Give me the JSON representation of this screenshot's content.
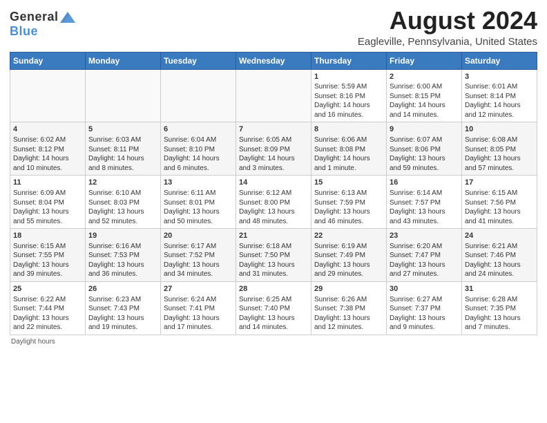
{
  "header": {
    "logo": {
      "general": "General",
      "blue": "Blue"
    },
    "title": "August 2024",
    "subtitle": "Eagleville, Pennsylvania, United States"
  },
  "calendar": {
    "weekdays": [
      "Sunday",
      "Monday",
      "Tuesday",
      "Wednesday",
      "Thursday",
      "Friday",
      "Saturday"
    ],
    "weeks": [
      [
        {
          "day": "",
          "content": ""
        },
        {
          "day": "",
          "content": ""
        },
        {
          "day": "",
          "content": ""
        },
        {
          "day": "",
          "content": ""
        },
        {
          "day": "1",
          "content": "Sunrise: 5:59 AM\nSunset: 8:16 PM\nDaylight: 14 hours and 16 minutes."
        },
        {
          "day": "2",
          "content": "Sunrise: 6:00 AM\nSunset: 8:15 PM\nDaylight: 14 hours and 14 minutes."
        },
        {
          "day": "3",
          "content": "Sunrise: 6:01 AM\nSunset: 8:14 PM\nDaylight: 14 hours and 12 minutes."
        }
      ],
      [
        {
          "day": "4",
          "content": "Sunrise: 6:02 AM\nSunset: 8:12 PM\nDaylight: 14 hours and 10 minutes."
        },
        {
          "day": "5",
          "content": "Sunrise: 6:03 AM\nSunset: 8:11 PM\nDaylight: 14 hours and 8 minutes."
        },
        {
          "day": "6",
          "content": "Sunrise: 6:04 AM\nSunset: 8:10 PM\nDaylight: 14 hours and 6 minutes."
        },
        {
          "day": "7",
          "content": "Sunrise: 6:05 AM\nSunset: 8:09 PM\nDaylight: 14 hours and 3 minutes."
        },
        {
          "day": "8",
          "content": "Sunrise: 6:06 AM\nSunset: 8:08 PM\nDaylight: 14 hours and 1 minute."
        },
        {
          "day": "9",
          "content": "Sunrise: 6:07 AM\nSunset: 8:06 PM\nDaylight: 13 hours and 59 minutes."
        },
        {
          "day": "10",
          "content": "Sunrise: 6:08 AM\nSunset: 8:05 PM\nDaylight: 13 hours and 57 minutes."
        }
      ],
      [
        {
          "day": "11",
          "content": "Sunrise: 6:09 AM\nSunset: 8:04 PM\nDaylight: 13 hours and 55 minutes."
        },
        {
          "day": "12",
          "content": "Sunrise: 6:10 AM\nSunset: 8:03 PM\nDaylight: 13 hours and 52 minutes."
        },
        {
          "day": "13",
          "content": "Sunrise: 6:11 AM\nSunset: 8:01 PM\nDaylight: 13 hours and 50 minutes."
        },
        {
          "day": "14",
          "content": "Sunrise: 6:12 AM\nSunset: 8:00 PM\nDaylight: 13 hours and 48 minutes."
        },
        {
          "day": "15",
          "content": "Sunrise: 6:13 AM\nSunset: 7:59 PM\nDaylight: 13 hours and 46 minutes."
        },
        {
          "day": "16",
          "content": "Sunrise: 6:14 AM\nSunset: 7:57 PM\nDaylight: 13 hours and 43 minutes."
        },
        {
          "day": "17",
          "content": "Sunrise: 6:15 AM\nSunset: 7:56 PM\nDaylight: 13 hours and 41 minutes."
        }
      ],
      [
        {
          "day": "18",
          "content": "Sunrise: 6:15 AM\nSunset: 7:55 PM\nDaylight: 13 hours and 39 minutes."
        },
        {
          "day": "19",
          "content": "Sunrise: 6:16 AM\nSunset: 7:53 PM\nDaylight: 13 hours and 36 minutes."
        },
        {
          "day": "20",
          "content": "Sunrise: 6:17 AM\nSunset: 7:52 PM\nDaylight: 13 hours and 34 minutes."
        },
        {
          "day": "21",
          "content": "Sunrise: 6:18 AM\nSunset: 7:50 PM\nDaylight: 13 hours and 31 minutes."
        },
        {
          "day": "22",
          "content": "Sunrise: 6:19 AM\nSunset: 7:49 PM\nDaylight: 13 hours and 29 minutes."
        },
        {
          "day": "23",
          "content": "Sunrise: 6:20 AM\nSunset: 7:47 PM\nDaylight: 13 hours and 27 minutes."
        },
        {
          "day": "24",
          "content": "Sunrise: 6:21 AM\nSunset: 7:46 PM\nDaylight: 13 hours and 24 minutes."
        }
      ],
      [
        {
          "day": "25",
          "content": "Sunrise: 6:22 AM\nSunset: 7:44 PM\nDaylight: 13 hours and 22 minutes."
        },
        {
          "day": "26",
          "content": "Sunrise: 6:23 AM\nSunset: 7:43 PM\nDaylight: 13 hours and 19 minutes."
        },
        {
          "day": "27",
          "content": "Sunrise: 6:24 AM\nSunset: 7:41 PM\nDaylight: 13 hours and 17 minutes."
        },
        {
          "day": "28",
          "content": "Sunrise: 6:25 AM\nSunset: 7:40 PM\nDaylight: 13 hours and 14 minutes."
        },
        {
          "day": "29",
          "content": "Sunrise: 6:26 AM\nSunset: 7:38 PM\nDaylight: 13 hours and 12 minutes."
        },
        {
          "day": "30",
          "content": "Sunrise: 6:27 AM\nSunset: 7:37 PM\nDaylight: 13 hours and 9 minutes."
        },
        {
          "day": "31",
          "content": "Sunrise: 6:28 AM\nSunset: 7:35 PM\nDaylight: 13 hours and 7 minutes."
        }
      ]
    ]
  },
  "footer": {
    "text": "Daylight hours"
  }
}
